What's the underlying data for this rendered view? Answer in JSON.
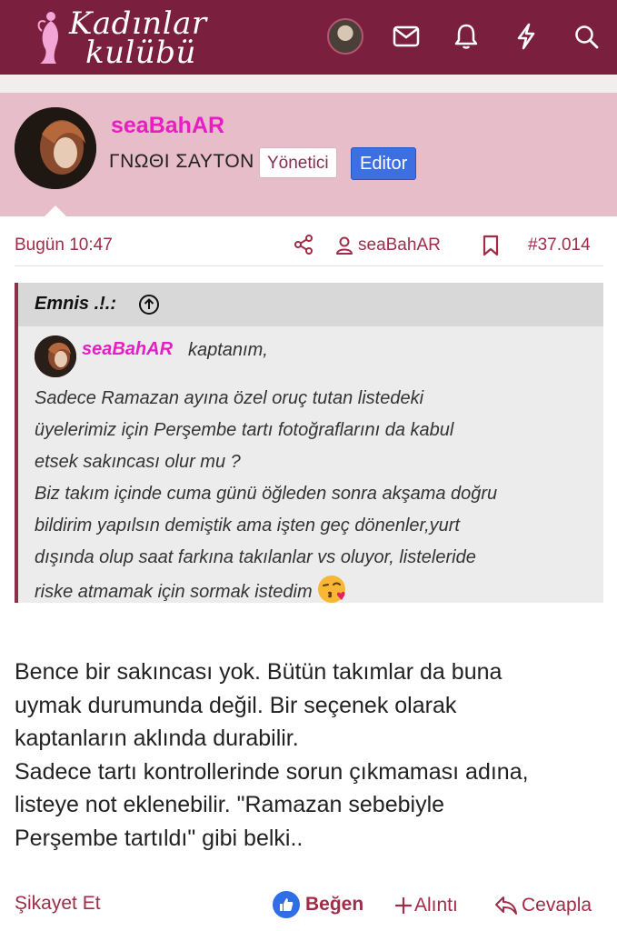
{
  "header": {
    "logo_line1": "Kadınlar",
    "logo_line2": "kulübü",
    "icons": [
      "user-avatar",
      "mail-icon",
      "bell-icon",
      "lightning-icon",
      "search-icon"
    ]
  },
  "post": {
    "author": "seaBahAR",
    "user_title": "ΓΝΩΘΙ ΣΑΥΤΟΝ",
    "badges": {
      "admin": "Yönetici",
      "editor": "Editor"
    },
    "time": "Bugün 10:47",
    "author_link": "seaBahAR",
    "post_number": "#37.014",
    "quote": {
      "author": "Emnis .!.:",
      "mention": "seaBahAR",
      "after_mention": "kaptanım,",
      "lines": [
        "Sadece Ramazan ayına özel oruç tutan listedeki",
        "üyelerimiz için Perşembe tartı fotoğraflarını da kabul",
        "etsek sakıncası olur mu ?",
        "Biz takım içinde cuma günü öğleden sonra akşama doğru",
        "bildirim yapılsın demiştik ama işten geç dönenler,yurt",
        "dışında olup saat farkına takılanlar vs oluyor, listeleride",
        "riske atmamak için sormak istedim"
      ]
    },
    "body_lines": [
      "Bence bir sakıncası yok. Bütün takımlar da buna",
      "uymak durumunda değil. Bir seçenek olarak",
      "kaptanların aklında durabilir.",
      "Sadece tartı kontrollerinde sorun çıkmaması adına,",
      "listeye not eklenebilir. \"Ramazan sebebiyle",
      "Perşembe tartıldı\" gibi belki.."
    ],
    "actions": {
      "report": "Şikayet Et",
      "like": "Beğen",
      "quote": "Alıntı",
      "reply": "Cevapla"
    }
  },
  "colors": {
    "header_bg": "#7a1f3d",
    "profile_bg": "#e7bdca",
    "username": "#e61ec4",
    "accent": "#a02c48",
    "editor_badge": "#3e6fe0"
  }
}
